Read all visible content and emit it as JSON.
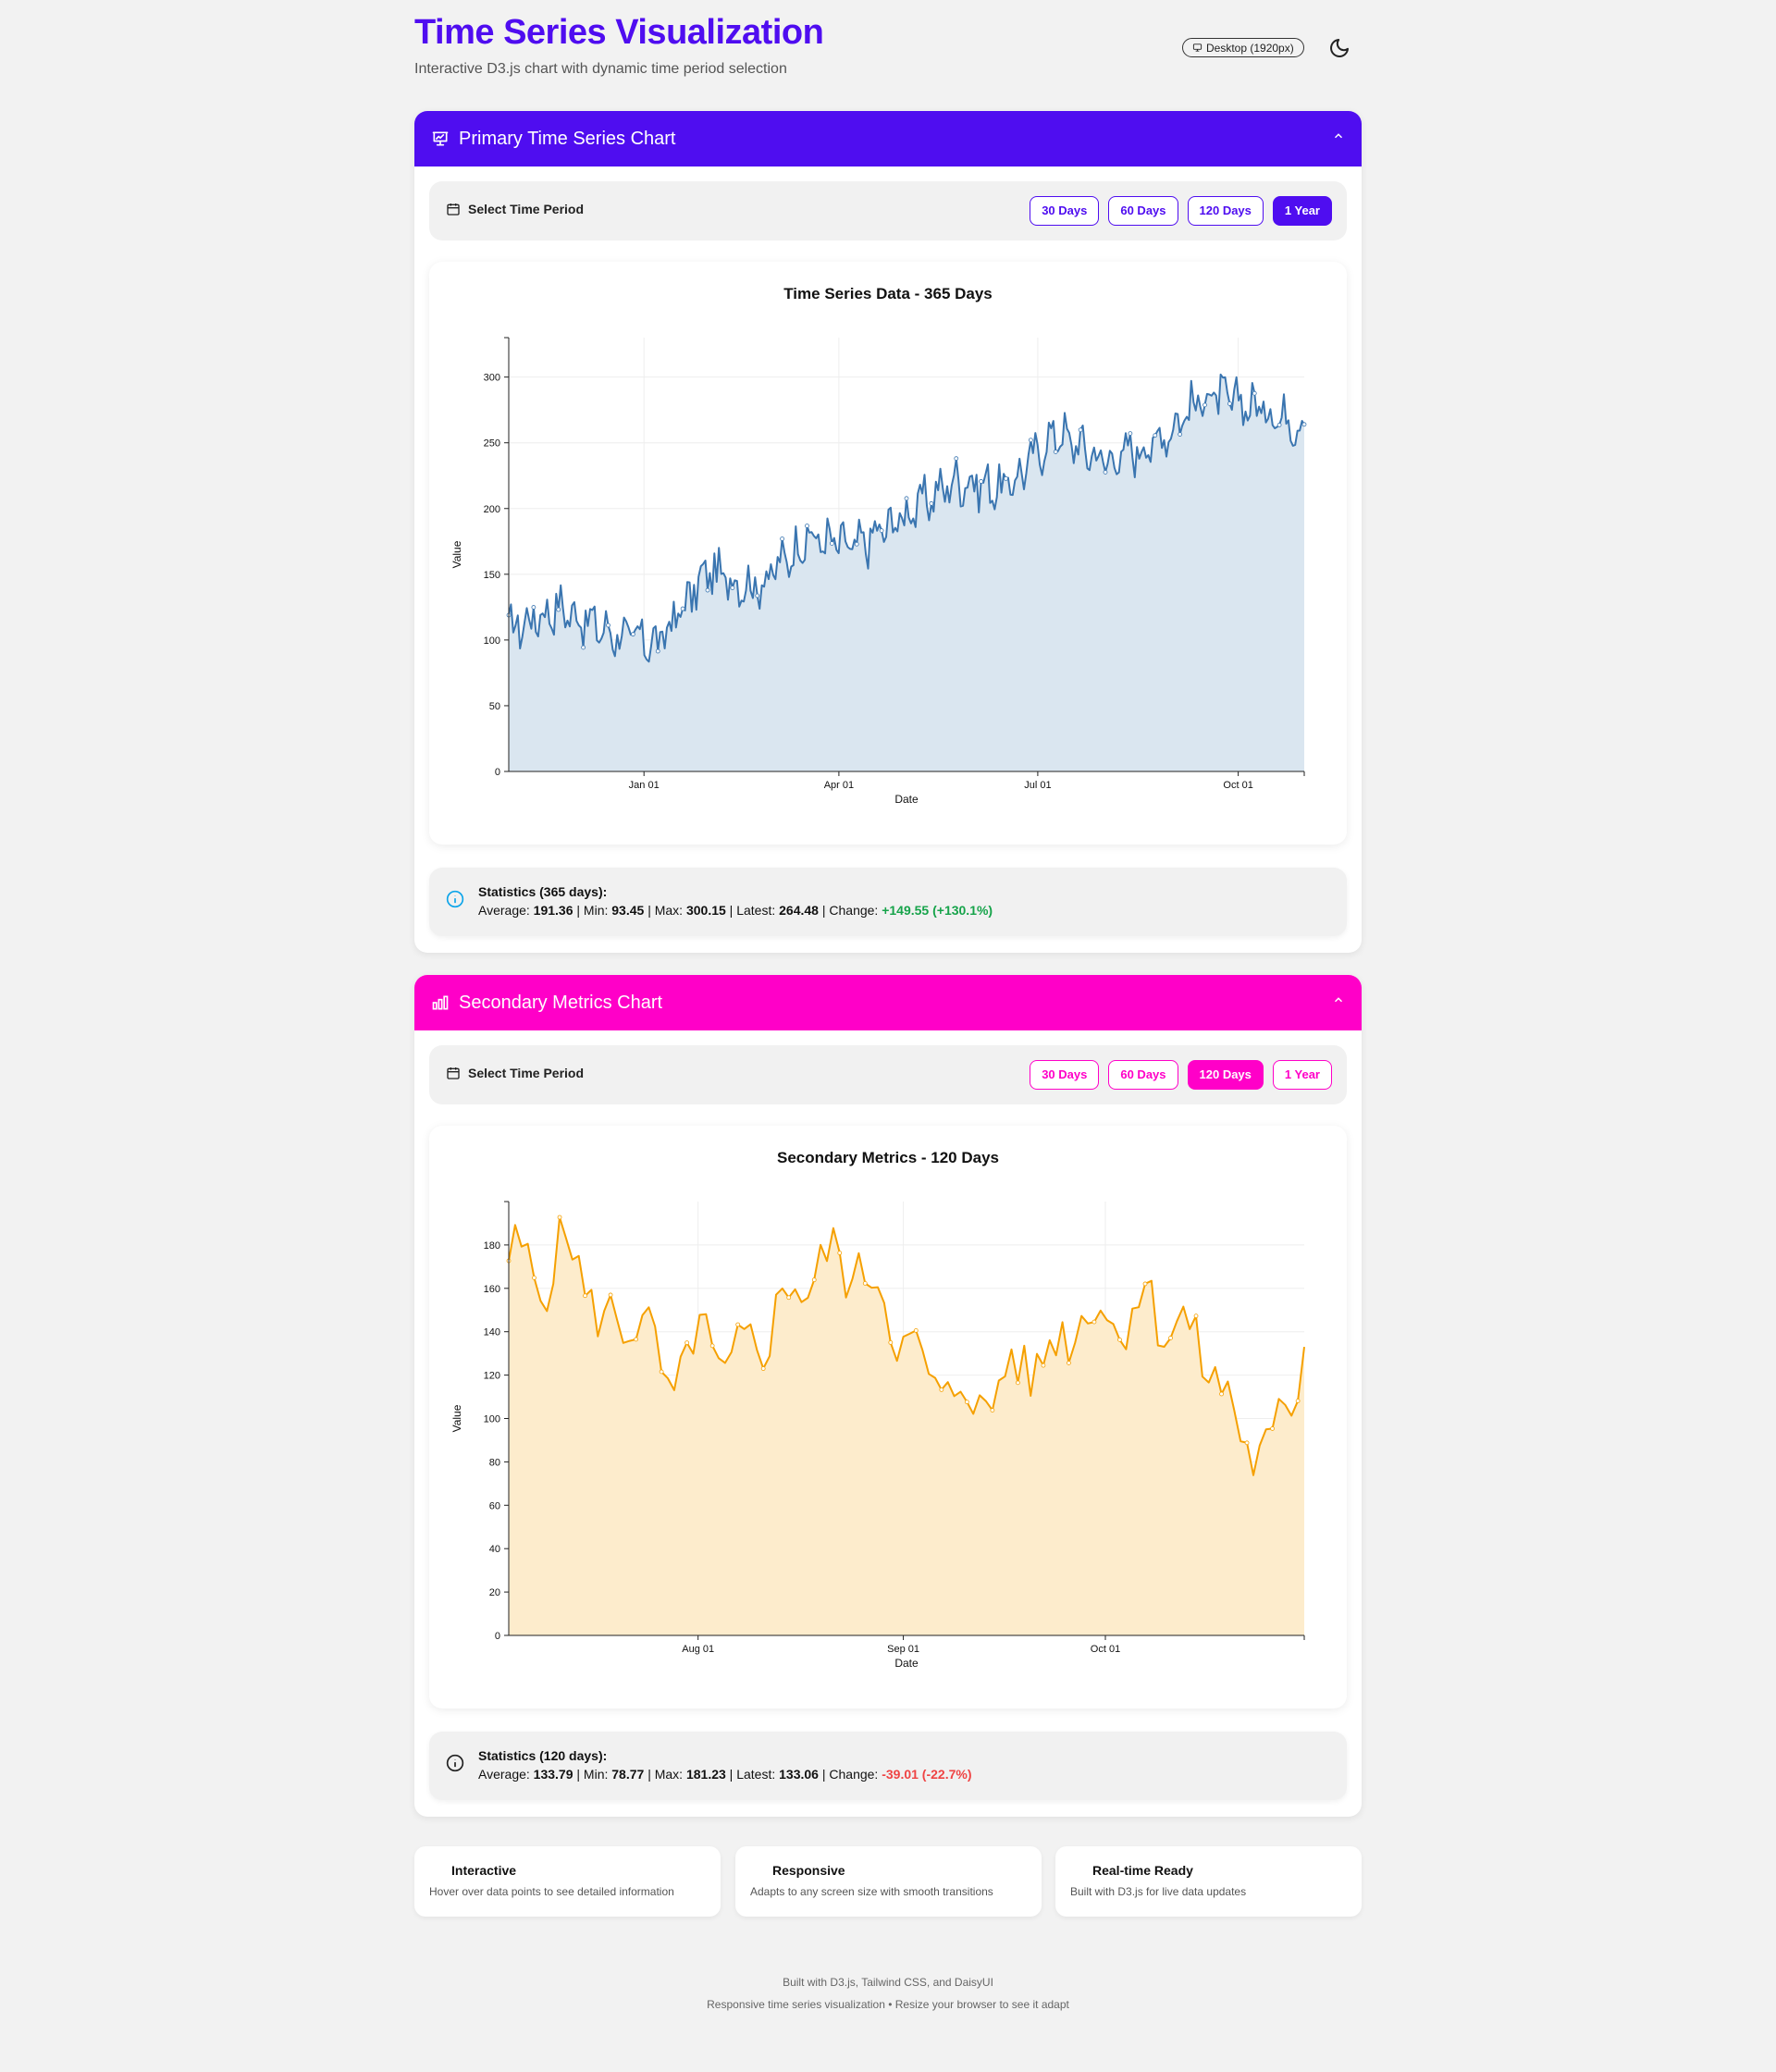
{
  "header": {
    "title": "Time Series Visualization",
    "subtitle": "Interactive D3.js chart with dynamic time period selection",
    "device_badge": "Desktop (1920px)"
  },
  "colors": {
    "primary": "#4f0df0",
    "secondary": "#ff00c8",
    "line1": "#3a75b0",
    "fill1": "#dae6f0",
    "line2": "#f5a000",
    "fill2": "#fdeccc",
    "positive": "#16a34a",
    "negative": "#ef4444"
  },
  "primary": {
    "title": "Primary Time Series Chart",
    "select_label": "Select Time Period",
    "periods": [
      "30 Days",
      "60 Days",
      "120 Days",
      "1 Year"
    ],
    "active": 3,
    "stats_title": "Statistics (365 days):",
    "stats": {
      "average": "191.36",
      "min": "93.45",
      "max": "300.15",
      "latest": "264.48",
      "change": "+149.55 (+130.1%)"
    }
  },
  "secondary": {
    "title": "Secondary Metrics Chart",
    "select_label": "Select Time Period",
    "periods": [
      "30 Days",
      "60 Days",
      "120 Days",
      "1 Year"
    ],
    "active": 2,
    "stats_title": "Statistics (120 days):",
    "stats": {
      "average": "133.79",
      "min": "78.77",
      "max": "181.23",
      "latest": "133.06",
      "change": "-39.01 (-22.7%)"
    }
  },
  "stat_labels": {
    "average": "Average:",
    "min": "Min:",
    "max": "Max:",
    "latest": "Latest:",
    "change": "Change:"
  },
  "features": [
    {
      "title": "Interactive",
      "desc": "Hover over data points to see detailed information"
    },
    {
      "title": "Responsive",
      "desc": "Adapts to any screen size with smooth transitions"
    },
    {
      "title": "Real-time Ready",
      "desc": "Built with D3.js for live data updates"
    }
  ],
  "footer": {
    "line1": "Built with D3.js, Tailwind CSS, and DaisyUI",
    "line2": "Responsive time series visualization • Resize your browser to see it adapt"
  },
  "chart_data": [
    {
      "type": "area",
      "title": "Time Series Data - 365 Days",
      "xlabel": "Date",
      "ylabel": "Value",
      "x_ticks": [
        "Jan 01",
        "Apr 01",
        "Jul 01",
        "Oct 01"
      ],
      "y_ticks": [
        0,
        50,
        100,
        150,
        200,
        250,
        300
      ],
      "ylim": [
        0,
        330
      ],
      "x": [
        "Nov 22",
        "Dec 15",
        "Jan 01",
        "Jan 25",
        "Feb 15",
        "Mar 10",
        "Apr 01",
        "Apr 25",
        "May 20",
        "Jun 10",
        "Jul 01",
        "Jul 25",
        "Aug 20",
        "Sep 10",
        "Oct 01",
        "Oct 20",
        "Nov 21"
      ],
      "values": [
        108,
        125,
        106,
        97,
        152,
        140,
        178,
        170,
        196,
        222,
        215,
        258,
        236,
        250,
        286,
        278,
        264
      ],
      "grid": true
    },
    {
      "type": "area",
      "title": "Secondary Metrics - 120 Days",
      "xlabel": "Date",
      "ylabel": "Value",
      "x_ticks": [
        "Aug 01",
        "Sep 01",
        "Oct 01"
      ],
      "y_ticks": [
        0,
        20,
        40,
        60,
        80,
        100,
        120,
        140,
        160,
        180
      ],
      "ylim": [
        0,
        200
      ],
      "x": [
        "Jul 04",
        "Jul 07",
        "Jul 10",
        "Jul 14",
        "Jul 19",
        "Jul 23",
        "Jul 28",
        "Aug 02",
        "Aug 07",
        "Aug 13",
        "Aug 18",
        "Aug 24",
        "Aug 29",
        "Sep 03",
        "Sep 09",
        "Sep 15",
        "Sep 20",
        "Sep 26",
        "Sep 30",
        "Oct 05",
        "Oct 10",
        "Oct 16",
        "Oct 20",
        "Oct 25",
        "Oct 30",
        "Nov 01"
      ],
      "values": [
        175,
        165,
        180,
        140,
        150,
        112,
        138,
        122,
        140,
        160,
        172,
        170,
        150,
        120,
        112,
        108,
        125,
        128,
        150,
        145,
        155,
        142,
        128,
        92,
        82,
        133
      ],
      "grid": true
    }
  ]
}
